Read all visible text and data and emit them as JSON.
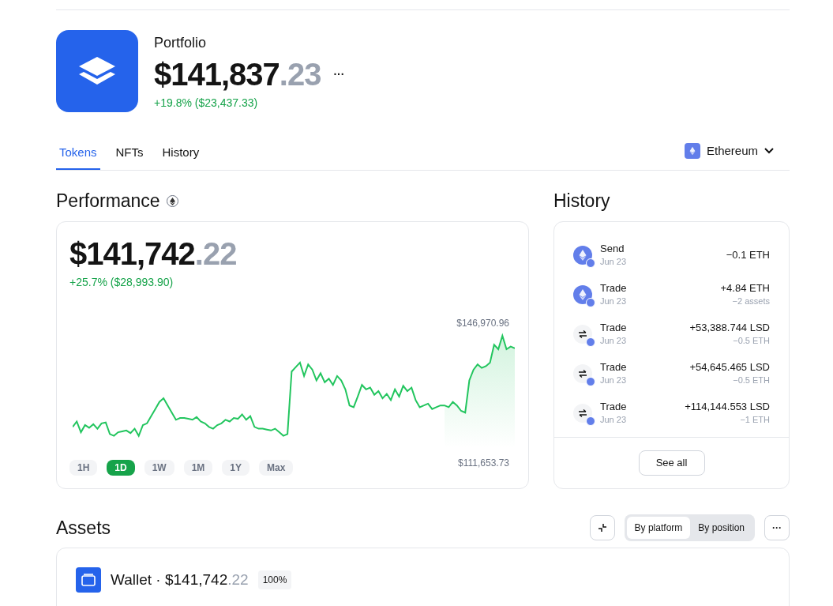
{
  "header": {
    "title": "Portfolio",
    "amount_whole": "$141,837",
    "amount_cents": ".23",
    "more": "···",
    "change": "+19.8% ($23,437.33)"
  },
  "tabs": [
    {
      "label": "Tokens",
      "selected": true
    },
    {
      "label": "NFTs",
      "selected": false
    },
    {
      "label": "History",
      "selected": false
    }
  ],
  "network": {
    "label": "Ethereum"
  },
  "performance": {
    "title": "Performance",
    "amount_whole": "$141,742",
    "amount_cents": ".22",
    "change": "+25.7% ($28,993.90)",
    "high": "$146,970.96",
    "low": "$111,653.73",
    "ranges": [
      {
        "label": "1H",
        "selected": false
      },
      {
        "label": "1D",
        "selected": true
      },
      {
        "label": "1W",
        "selected": false
      },
      {
        "label": "1M",
        "selected": false
      },
      {
        "label": "1Y",
        "selected": false
      },
      {
        "label": "Max",
        "selected": false
      }
    ]
  },
  "history": {
    "title": "History",
    "see_all": "See all",
    "items": [
      {
        "kind": "eth",
        "action": "Send",
        "date": "Jun 23",
        "amount": "−0.1 ETH"
      },
      {
        "kind": "eth",
        "action": "Trade",
        "date": "Jun 23",
        "amount": "+4.84 ETH",
        "detail": "−2 assets"
      },
      {
        "kind": "swap",
        "action": "Trade",
        "date": "Jun 23",
        "amount": "+53,388.744 LSD",
        "detail": "−0.5 ETH"
      },
      {
        "kind": "swap",
        "action": "Trade",
        "date": "Jun 23",
        "amount": "+54,645.465 LSD",
        "detail": "−0.5 ETH"
      },
      {
        "kind": "swap",
        "action": "Trade",
        "date": "Jun 23",
        "amount": "+114,144.553 LSD",
        "detail": "−1 ETH"
      }
    ]
  },
  "assets": {
    "title": "Assets",
    "more": "···",
    "views": [
      {
        "label": "By platform",
        "selected": true
      },
      {
        "label": "By position",
        "selected": false
      }
    ],
    "wallet": {
      "title": "Wallet · $141,742",
      "cents": ".22",
      "share": "100%"
    }
  }
}
